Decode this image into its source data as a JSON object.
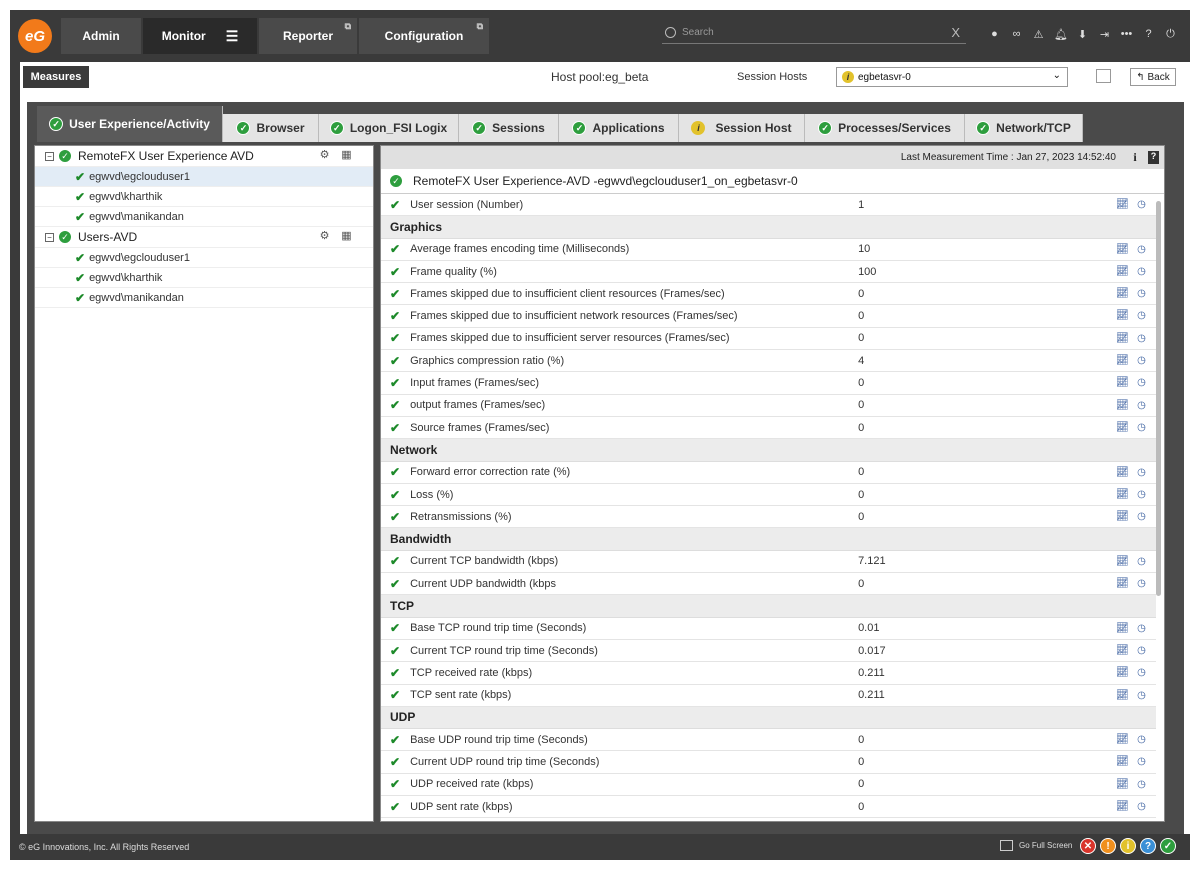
{
  "nav": {
    "logo": "eG",
    "items": [
      {
        "label": "Admin"
      },
      {
        "label": "Monitor"
      },
      {
        "label": "Reporter"
      },
      {
        "label": "Configuration"
      }
    ],
    "search_placeholder": "Search",
    "clear": "X"
  },
  "toolbar": {
    "measures_label": "Measures",
    "host_pool": "Host pool:eg_beta",
    "session_hosts_label": "Session Hosts",
    "session_host_value": "egbetasvr-0",
    "back_label": "Back"
  },
  "tabs": [
    {
      "label": "User Experience/Activity",
      "status": "ok"
    },
    {
      "label": "Browser",
      "status": "ok"
    },
    {
      "label": "Logon_FSI Logix",
      "status": "ok"
    },
    {
      "label": "Sessions",
      "status": "ok"
    },
    {
      "label": "Applications",
      "status": "ok"
    },
    {
      "label": "Session Host",
      "status": "warning"
    },
    {
      "label": "Processes/Services",
      "status": "ok"
    },
    {
      "label": "Network/TCP",
      "status": "ok"
    }
  ],
  "tree": {
    "groups": [
      {
        "label": "RemoteFX User Experience AVD",
        "items": [
          "egwvd\\egclouduser1",
          "egwvd\\kharthik",
          "egwvd\\manikandan"
        ]
      },
      {
        "label": "Users-AVD",
        "items": [
          "egwvd\\egclouduser1",
          "egwvd\\kharthik",
          "egwvd\\manikandan"
        ]
      }
    ]
  },
  "measurements": {
    "last_time": "Last Measurement Time : Jan 27, 2023 14:52:40",
    "info": "i",
    "help": "?",
    "test_title": "RemoteFX User Experience-AVD -egwvd\\egclouduser1_on_egbetasvr-0",
    "top_rows": [
      {
        "name": "User session (Number)",
        "value": "1"
      }
    ],
    "sections": [
      {
        "title": "Graphics",
        "rows": [
          {
            "name": "Average frames encoding time (Milliseconds)",
            "value": "10"
          },
          {
            "name": "Frame quality (%)",
            "value": "100"
          },
          {
            "name": "Frames skipped due to insufficient client resources (Frames/sec)",
            "value": "0"
          },
          {
            "name": "Frames skipped due to insufficient network resources (Frames/sec)",
            "value": "0"
          },
          {
            "name": "Frames skipped due to insufficient server resources (Frames/sec)",
            "value": "0"
          },
          {
            "name": "Graphics compression ratio (%)",
            "value": "4"
          },
          {
            "name": "Input frames (Frames/sec)",
            "value": "0"
          },
          {
            "name": "output frames (Frames/sec)",
            "value": "0"
          },
          {
            "name": "Source frames (Frames/sec)",
            "value": "0"
          }
        ]
      },
      {
        "title": "Network",
        "rows": [
          {
            "name": "Forward error correction rate (%)",
            "value": "0"
          },
          {
            "name": "Loss (%)",
            "value": "0"
          },
          {
            "name": "Retransmissions (%)",
            "value": "0"
          }
        ]
      },
      {
        "title": "Bandwidth",
        "rows": [
          {
            "name": "Current TCP bandwidth (kbps)",
            "value": "7.121"
          },
          {
            "name": "Current UDP bandwidth (kbps",
            "value": "0"
          }
        ]
      },
      {
        "title": "TCP",
        "rows": [
          {
            "name": "Base TCP round trip time (Seconds)",
            "value": "0.01"
          },
          {
            "name": "Current TCP round trip time (Seconds)",
            "value": "0.017"
          },
          {
            "name": "TCP received rate (kbps)",
            "value": "0.211"
          },
          {
            "name": "TCP sent rate (kbps)",
            "value": "0.211"
          }
        ]
      },
      {
        "title": "UDP",
        "rows": [
          {
            "name": "Base UDP round trip time (Seconds)",
            "value": "0"
          },
          {
            "name": "Current UDP round trip time (Seconds)",
            "value": "0"
          },
          {
            "name": "UDP received rate (kbps)",
            "value": "0"
          },
          {
            "name": "UDP sent rate (kbps)",
            "value": "0"
          }
        ]
      }
    ]
  },
  "footer": {
    "copyright": "© eG Innovations, Inc. All Rights Reserved",
    "go_full_screen": "Go Full Screen",
    "status_icons": [
      {
        "name": "critical-icon",
        "glyph": "✕",
        "color": "#d9342b"
      },
      {
        "name": "major-icon",
        "glyph": "!",
        "color": "#f0901e"
      },
      {
        "name": "minor-icon",
        "glyph": "i",
        "color": "#e2c22c"
      },
      {
        "name": "unknown-icon",
        "glyph": "?",
        "color": "#3a8fd6"
      },
      {
        "name": "normal-icon",
        "glyph": "✓",
        "color": "#2e9e3e"
      }
    ]
  },
  "colors": {
    "accent": "#f27a1a",
    "ok": "#2e9e3e",
    "warning": "#e2c22c",
    "topbar": "#3a3a3a"
  }
}
